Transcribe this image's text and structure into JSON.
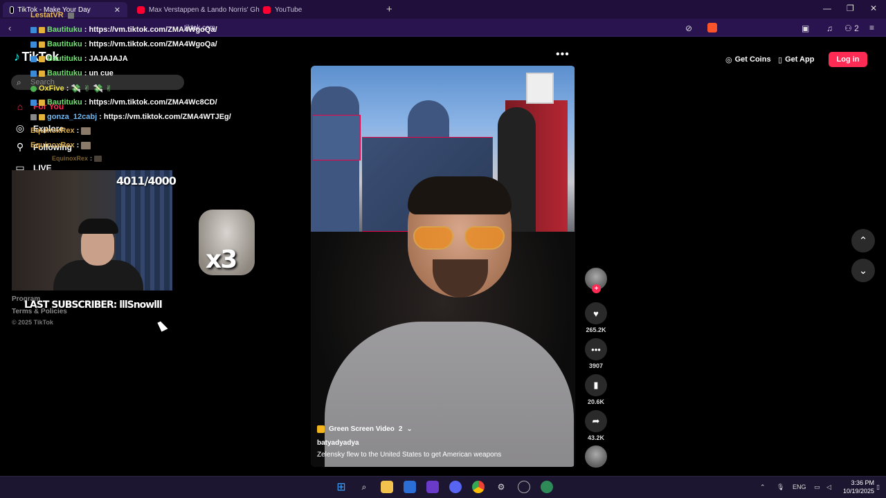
{
  "browser": {
    "tabs": [
      {
        "label": "TikTok - Make Your Day",
        "favicon_color": "#000000",
        "active": true
      },
      {
        "label": "Max Verstappen & Lando Norris' Gh",
        "favicon_color": "#ff0033",
        "active": false
      },
      {
        "label": "YouTube",
        "favicon_color": "#ff0033",
        "active": false
      }
    ],
    "url": "tiktok.com",
    "extension_count": "2"
  },
  "tiktok": {
    "logo": "TikTok",
    "search_placeholder": "Search",
    "sidebar": [
      {
        "label": "For You",
        "icon": "home-icon"
      },
      {
        "label": "Explore",
        "icon": "compass-icon"
      },
      {
        "label": "Following",
        "icon": "following-icon"
      },
      {
        "label": "LIVE",
        "icon": "live-icon"
      }
    ],
    "footer": {
      "program": "Program",
      "terms": "Terms & Policies",
      "copyright": "© 2025 TikTok"
    },
    "header": {
      "get_coins": "Get Coins",
      "get_app": "Get App",
      "login": "Log in"
    },
    "video": {
      "tag": "Green Screen Video",
      "tag_count": "2",
      "author": "batyadyadya",
      "description": "Zelensky flew to the United States to get American weapons"
    },
    "actions": {
      "likes": "265.2K",
      "comments": "3907",
      "saves": "20.6K",
      "shares": "43.2K"
    },
    "accent_color": "#fe2c55"
  },
  "stream_overlay": {
    "chat": [
      {
        "user": "LestatVR",
        "user_color": "#e8b84a",
        "message": ""
      },
      {
        "user": "Bautituku",
        "user_color": "#6fe36f",
        "message": ": https://vm.tiktok.com/ZMA4WgoQa/"
      },
      {
        "user": "Bautituku",
        "user_color": "#6fe36f",
        "message": ": https://vm.tiktok.com/ZMA4WgoQa/"
      },
      {
        "user": "Bautituku",
        "user_color": "#6fe36f",
        "message": ": JAJAJAJA"
      },
      {
        "user": "Bautituku",
        "user_color": "#6fe36f",
        "message": ": un cue"
      },
      {
        "user": "OxFive",
        "user_color": "#f2e34a",
        "message": ":"
      },
      {
        "user": "Bautituku",
        "user_color": "#6fe36f",
        "message": ": https://vm.tiktok.com/ZMA4Wc8CD/"
      },
      {
        "user": "gonza_12cabj",
        "user_color": "#6fb8f2",
        "message": ": https://vm.tiktok.com/ZMA4WTJEg/"
      },
      {
        "user": "EquinoxRex",
        "user_color": "#d9a94a",
        "message": ":"
      },
      {
        "user": "EquinoxRex",
        "user_color": "#d9a94a",
        "message": ":"
      },
      {
        "user": "EquinoxRex",
        "user_color": "#b08840",
        "message": ":"
      }
    ],
    "sub_goal": "4011/4000",
    "last_subscriber": "LAST SUBSCRIBER: lllSnowlll",
    "emote_multiplier": "x3"
  },
  "taskbar": {
    "language": "ENG",
    "time": "3:36 PM",
    "date": "10/19/2025"
  }
}
